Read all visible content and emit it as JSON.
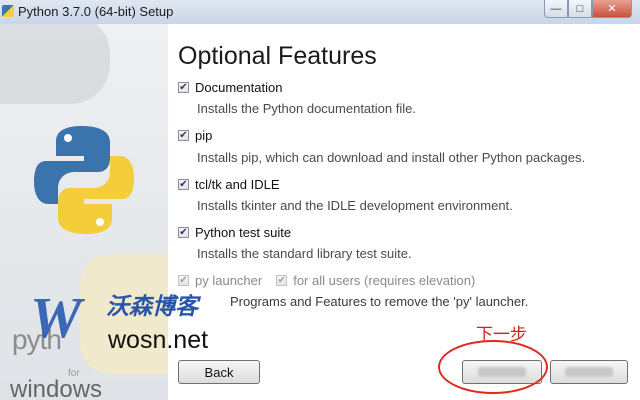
{
  "window": {
    "title": "Python 3.7.0 (64-bit) Setup",
    "controls": [
      "minimize",
      "maximize",
      "close"
    ]
  },
  "sidebar": {
    "brand_python": "pyth",
    "brand_for": "for",
    "brand_windows": "windows"
  },
  "main": {
    "heading": "Optional Features",
    "options": [
      {
        "label": "Documentation",
        "checked": true,
        "description": "Installs the Python documentation file."
      },
      {
        "label": "pip",
        "checked": true,
        "description": "Installs pip, which can download and install other Python packages."
      },
      {
        "label": "tcl/tk and IDLE",
        "checked": true,
        "description": "Installs tkinter and the IDLE development environment."
      },
      {
        "label": "Python test suite",
        "checked": true,
        "description": "Installs the standard library test suite."
      }
    ],
    "launcher": {
      "py_label": "py launcher",
      "all_users_label": "for all users (requires elevation)",
      "note_tail": "Programs and Features to remove the 'py' launcher."
    }
  },
  "buttons": {
    "back": "Back"
  },
  "watermark": {
    "letter": "W",
    "chinese": "沃森博客",
    "url": "wosn.net"
  },
  "annotation": {
    "text": "下一步",
    "color": "#d22318"
  },
  "colors": {
    "accent": "#2a5bb0",
    "annotation": "#e02a1c"
  }
}
